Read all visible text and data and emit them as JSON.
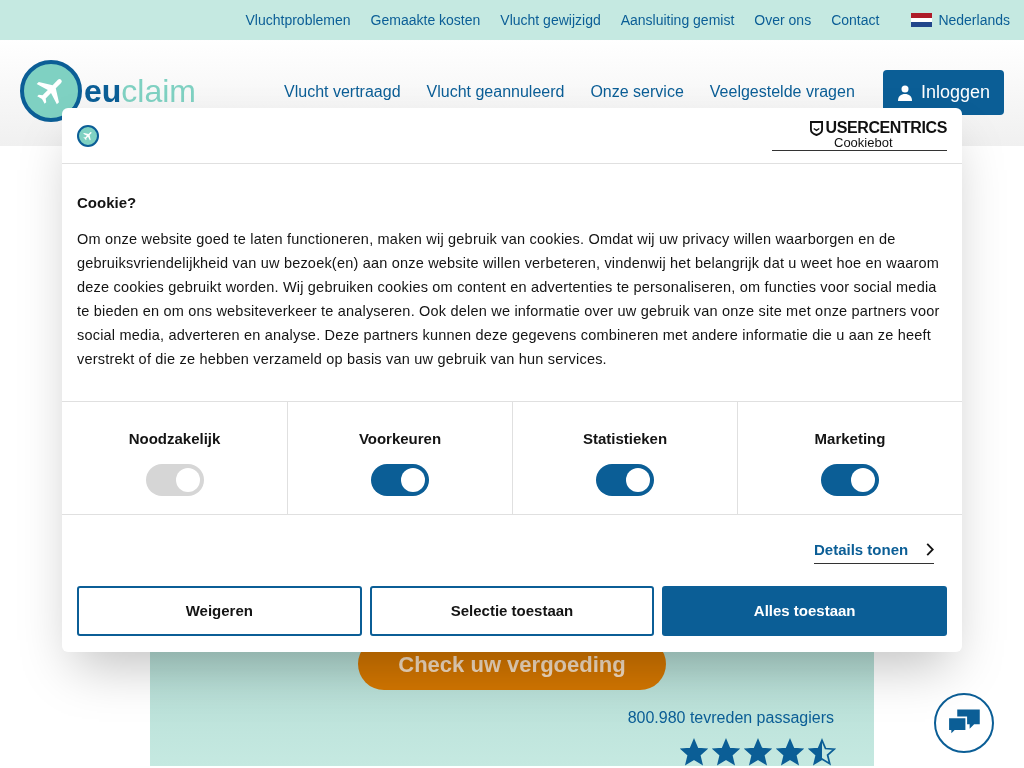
{
  "top_bar": {
    "links": [
      "Vluchtproblemen",
      "Gemaakte kosten",
      "Vlucht gewijzigd",
      "Aansluiting gemist",
      "Over ons",
      "Contact"
    ],
    "language": "Nederlands"
  },
  "header": {
    "logo": {
      "part1": "eu",
      "part2": "claim"
    },
    "nav": [
      "Vlucht vertraagd",
      "Vlucht geannuleerd",
      "Onze service",
      "Veelgestelde vragen"
    ],
    "login": "Inloggen"
  },
  "hero": {
    "cta": "Check uw vergoeding",
    "passengers": "800.980 tevreden passagiers",
    "stars": 4.5
  },
  "cookie_dialog": {
    "brand": "USERCENTRICS",
    "brand_sub": "Cookiebot",
    "title": "Cookie?",
    "text": "Om onze website goed te laten functioneren, maken wij gebruik van cookies. Omdat wij uw privacy willen waarborgen en de gebruiksvriendelijkheid van uw bezoek(en) aan onze website willen verbeteren, vindenwij het belangrijk dat u weet hoe en waarom deze cookies gebruikt worden. Wij gebruiken cookies om content en advertenties te personaliseren, om functies voor social media te bieden en om ons websiteverkeer te analyseren. Ook delen we informatie over uw gebruik van onze site met onze partners voor social media, adverteren en analyse. Deze partners kunnen deze gegevens combineren met andere informatie die u aan ze heeft verstrekt of die ze hebben verzameld op basis van uw gebruik van hun services.",
    "categories": [
      {
        "label": "Noodzakelijk",
        "on": true,
        "disabled": true
      },
      {
        "label": "Voorkeuren",
        "on": true,
        "disabled": false
      },
      {
        "label": "Statistieken",
        "on": true,
        "disabled": false
      },
      {
        "label": "Marketing",
        "on": true,
        "disabled": false
      }
    ],
    "details_link": "Details tonen",
    "buttons": [
      {
        "label": "Weigeren",
        "kind": "outline"
      },
      {
        "label": "Selectie toestaan",
        "kind": "outline"
      },
      {
        "label": "Alles toestaan",
        "kind": "primary"
      }
    ]
  }
}
